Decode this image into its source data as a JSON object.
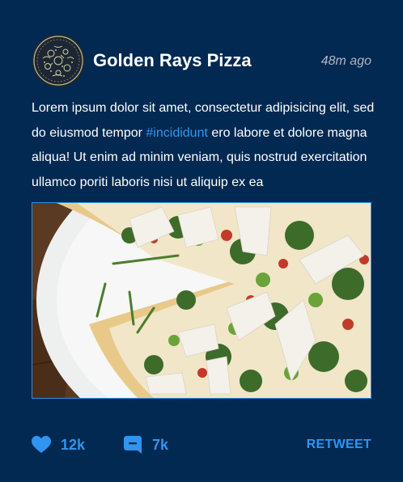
{
  "post": {
    "username": "Golden Rays Pizza",
    "timestamp": "48m ago",
    "text_before": "Lorem ipsum dolor sit amet, consectetur adipisicing elit, sed do eiusmod tempor ",
    "hashtag": "#incididunt",
    "text_after": " ero labore et dolore magna aliqua! Ut enim ad minim veniam, quis nostrud exercitation ullamco poriti laboris nisi ut aliquip ex ea",
    "image_subject": "pizza-photo"
  },
  "actions": {
    "likes": "12k",
    "comments": "7k",
    "retweet_label": "RETWEET"
  },
  "colors": {
    "background": "#022951",
    "accent": "#2f95f0",
    "timestamp": "#aeb7c3"
  },
  "icons": {
    "like": "heart-icon",
    "comment": "comment-bubble-icon",
    "avatar": "pizza-logo"
  }
}
